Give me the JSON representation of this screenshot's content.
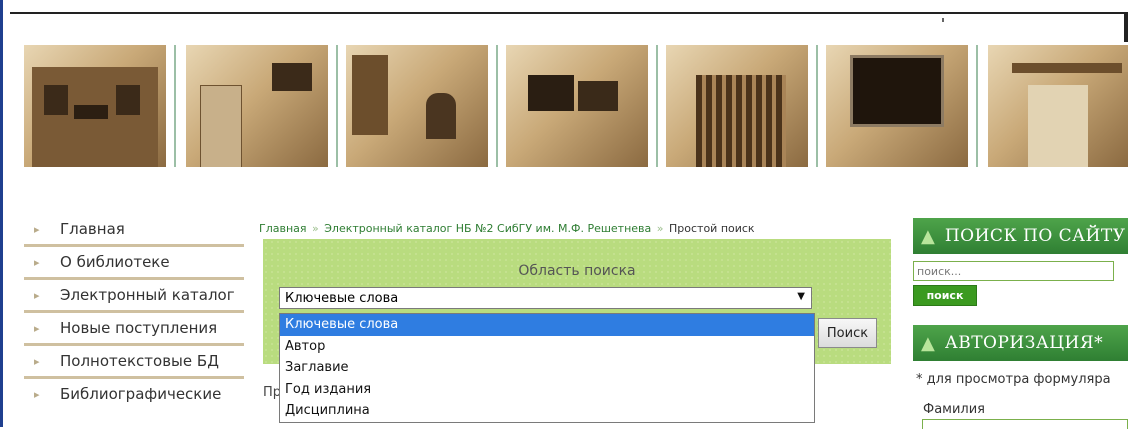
{
  "banner": {
    "photos": [
      "library-building-photo",
      "book-tower-photo",
      "reading-room-photo",
      "computer-lab-photo",
      "bookshelves-photo",
      "monitor-scanner-photo",
      "building-interior-photo"
    ]
  },
  "sidebar": {
    "items": [
      {
        "label": "Главная"
      },
      {
        "label": "О библиотеке"
      },
      {
        "label": "Электронный каталог"
      },
      {
        "label": "Новые поступления"
      },
      {
        "label": "Полнотекстовые БД"
      },
      {
        "label": "Библиографические"
      }
    ]
  },
  "breadcrumb": {
    "home": "Главная",
    "catalog": "Электронный каталог НБ №2 СибГУ им. М.Ф. Решетнева",
    "current": "Простой поиск",
    "separator": "»"
  },
  "search": {
    "area_title": "Область поиска",
    "selected": "Ключевые слова",
    "options": [
      "Ключевые слова",
      "Автор",
      "Заглавие",
      "Год издания",
      "Дисциплина"
    ],
    "button_label": "Поиск",
    "hidden_label_fragment": "Пр"
  },
  "right_panel": {
    "site_search_title": "ПОИСК ПО САЙТУ",
    "site_search_placeholder": "поиск...",
    "site_search_button": "поиск",
    "auth_title": "АВТОРИЗАЦИЯ*",
    "auth_note": "* для просмотра формуляра",
    "surname_label": "Фамилия"
  },
  "colors": {
    "accent_green": "#3d8f3f",
    "panel_green": "#b9dc7f",
    "link_green": "#2e7d32",
    "selection_blue": "#2f7de1"
  }
}
